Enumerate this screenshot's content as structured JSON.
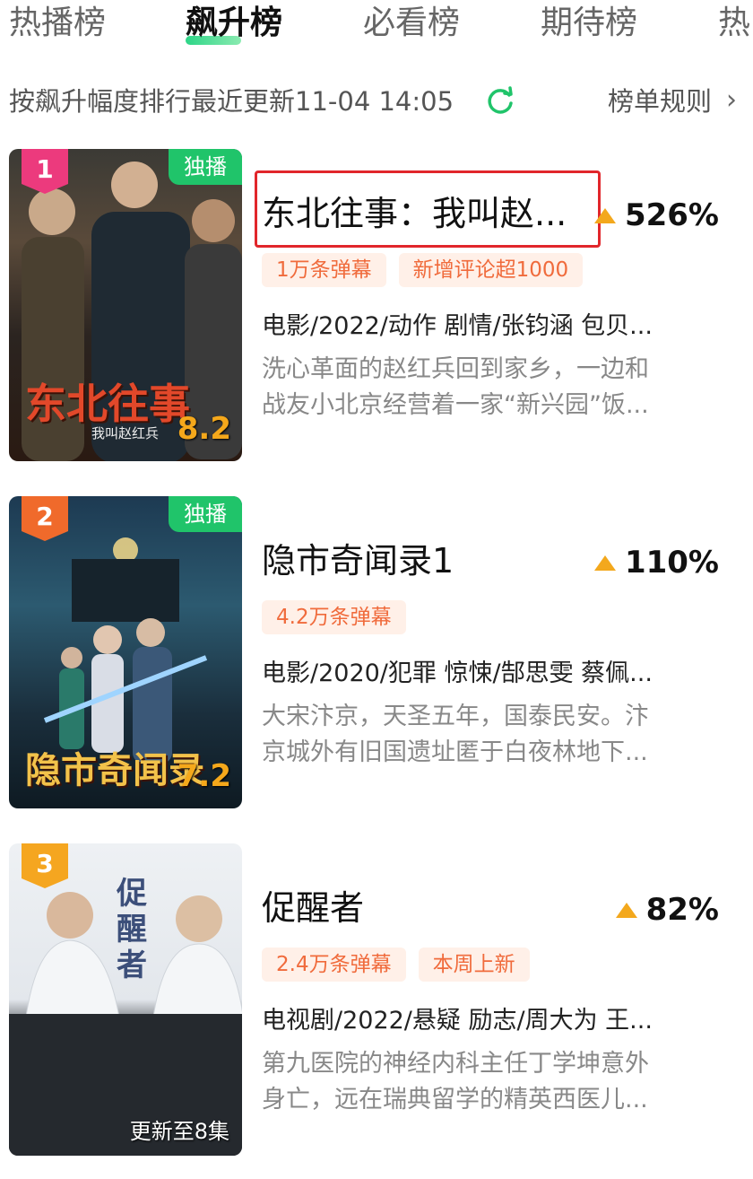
{
  "tabs": [
    "热播榜",
    "飙升榜",
    "必看榜",
    "期待榜",
    "热"
  ],
  "active_tab": "飙升榜",
  "subbar": {
    "rank_desc": "按飙升幅度排行最近更新11-04 14:05",
    "rules_label": "榜单规则"
  },
  "colors": {
    "accent_green": "#20c46a",
    "rise_arrow": "#f3a81d",
    "tag_text": "#f06b3c",
    "tag_bg": "#fff0e8",
    "highlight_box": "#e1262b"
  },
  "items": [
    {
      "rank": "1",
      "rank_color": "#ec3a7d",
      "exclusive_label": "独播",
      "poster_title": "东北往事",
      "poster_subtitle": "我叫赵红兵",
      "poster_score": "8.2",
      "title": "东北往事：我叫赵...",
      "rise": "526%",
      "tags": [
        "1万条弹幕",
        "新增评论超1000"
      ],
      "meta": "电影/2022/动作 剧情/张钧涵 包贝...",
      "desc_lines": [
        "洗心革面的赵红兵回到家乡，一边和",
        "战友小北京经营着一家“新兴园”饭..."
      ]
    },
    {
      "rank": "2",
      "rank_color": "#f06a2b",
      "exclusive_label": "独播",
      "poster_title": "隐市奇闻录",
      "poster_score": "7.2",
      "title": "隐市奇闻录1",
      "rise": "110%",
      "tags": [
        "4.2万条弹幕"
      ],
      "meta": "电影/2020/犯罪 惊悚/郜思雯 蔡佩...",
      "desc_lines": [
        "大宋汴京，天圣五年，国泰民安。汴",
        "京城外有旧国遗址匿于白夜林地下..."
      ]
    },
    {
      "rank": "3",
      "rank_color": "#f5a620",
      "poster_title": "促醒者",
      "update_label": "更新至8集",
      "title": "促醒者",
      "rise": "82%",
      "tags": [
        "2.4万条弹幕",
        "本周上新"
      ],
      "meta": "电视剧/2022/悬疑 励志/周大为 王...",
      "desc_lines": [
        "第九医院的神经内科主任丁学坤意外",
        "身亡，远在瑞典留学的精英西医儿..."
      ]
    }
  ]
}
